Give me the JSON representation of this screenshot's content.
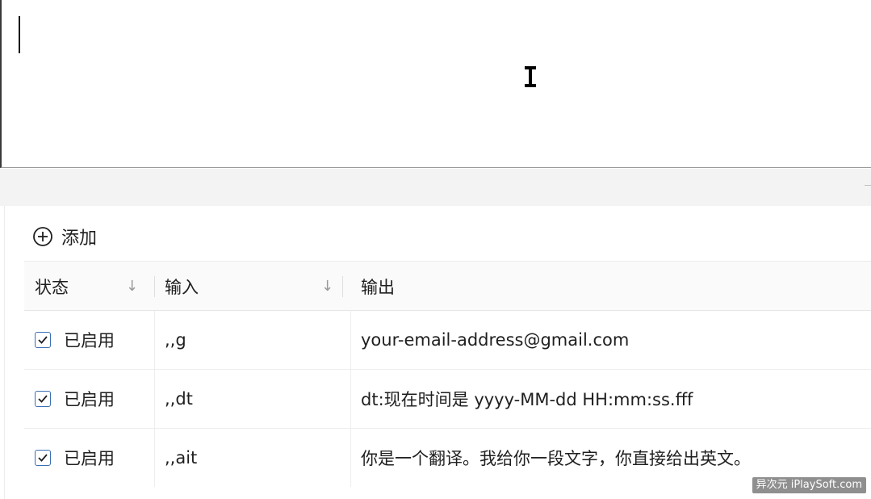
{
  "toolbar": {
    "add_label": "添加"
  },
  "table": {
    "columns": [
      "状态",
      "输入",
      "输出"
    ],
    "rows": [
      {
        "status": "已启用",
        "input": ",,g",
        "output": "your-email-address@gmail.com"
      },
      {
        "status": "已启用",
        "input": ",,dt",
        "output": "dt:现在时间是 yyyy-MM-dd HH:mm:ss.fff"
      },
      {
        "status": "已启用",
        "input": ",,ait",
        "output": "你是一个翻译。我给你一段文字，你直接给出英文。"
      }
    ]
  },
  "watermark": "异次元 iPlaySoft.com",
  "icons": {
    "add": "plus-circle-icon",
    "sort": "arrow-down-icon",
    "check": "checkmark-icon",
    "cursor": "ibeam-cursor-icon"
  },
  "colors": {
    "checkbox_border": "#3b6fb5",
    "header_bg": "#fafafa",
    "band_bg": "#f3f3f3"
  }
}
